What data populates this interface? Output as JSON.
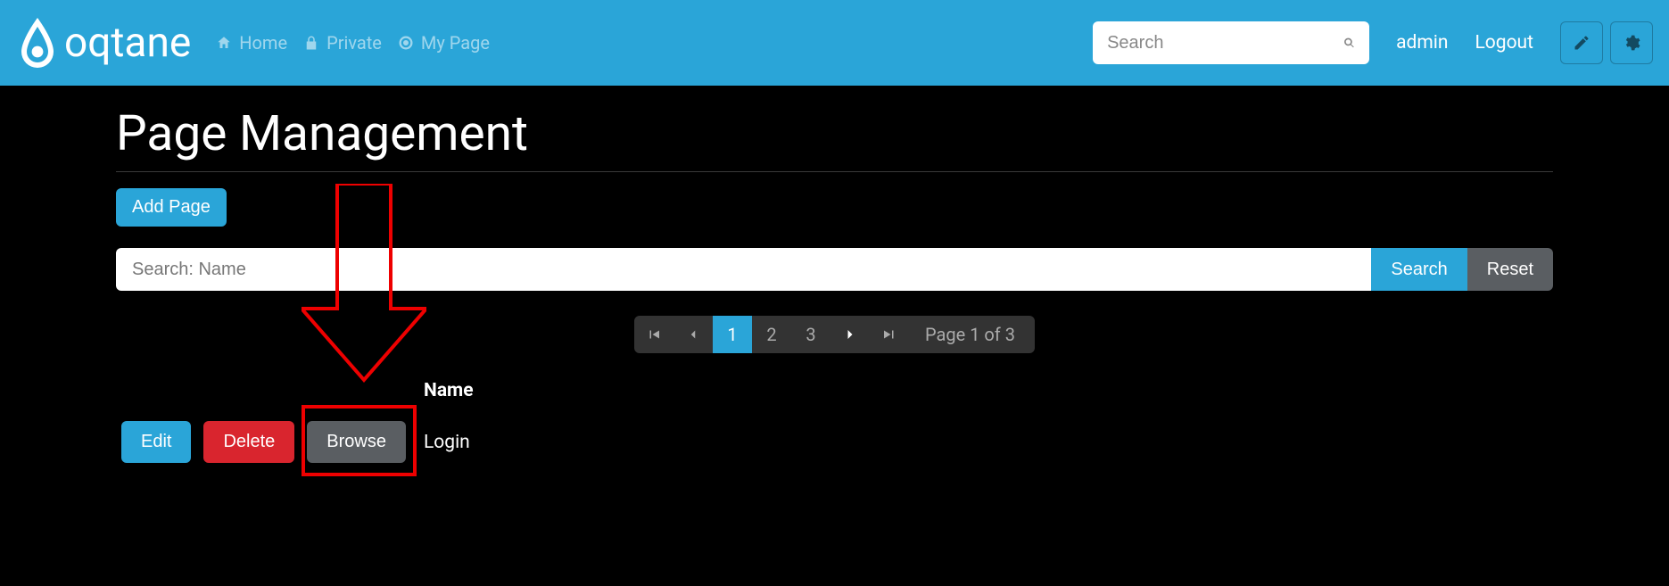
{
  "brand": "oqtane",
  "nav": [
    {
      "label": "Home",
      "icon": "home"
    },
    {
      "label": "Private",
      "icon": "lock"
    },
    {
      "label": "My Page",
      "icon": "target"
    }
  ],
  "header": {
    "search_placeholder": "Search",
    "user": "admin",
    "logout": "Logout"
  },
  "page": {
    "title": "Page Management",
    "add_label": "Add Page",
    "search_placeholder": "Search: Name",
    "search_btn": "Search",
    "reset_btn": "Reset"
  },
  "pager": {
    "pages": [
      "1",
      "2",
      "3"
    ],
    "active_index": 0,
    "summary": "Page 1 of 3"
  },
  "table": {
    "header_name": "Name",
    "edit_label": "Edit",
    "delete_label": "Delete",
    "browse_label": "Browse",
    "rows": [
      {
        "name": "Login"
      }
    ]
  }
}
